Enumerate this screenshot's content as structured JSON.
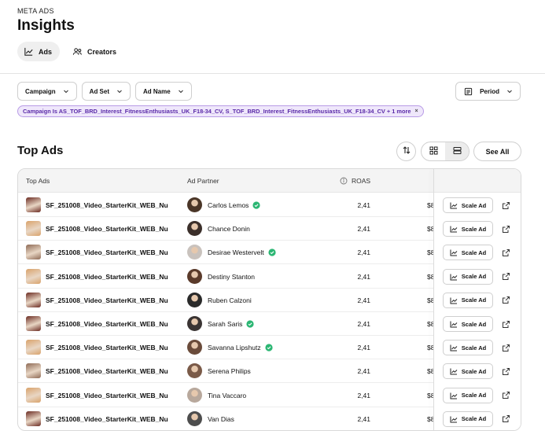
{
  "header": {
    "eyebrow": "META ADS",
    "title": "Insights"
  },
  "tabs": [
    {
      "label": "Ads",
      "icon": "line-chart-icon",
      "active": true
    },
    {
      "label": "Creators",
      "icon": "users-icon",
      "active": false
    }
  ],
  "filters": {
    "campaign": "Campaign",
    "ad_set": "Ad Set",
    "ad_name": "Ad Name",
    "period": "Period"
  },
  "active_filter": {
    "text": "Campaign Is AS_TOF_BRD_Interest_FitnessEnthusiasts_UK_F18-34_CV, S_TOF_BRD_Interest_FitnessEnthusiasts_UK_F18-34_CV + 1 more",
    "remove": "×"
  },
  "section": {
    "title": "Top Ads",
    "see_all": "See All"
  },
  "table": {
    "headers": {
      "ads": "Top Ads",
      "partner": "Ad Partner",
      "roas": "ROAS"
    },
    "scale_label": "Scale Ad",
    "rows": [
      {
        "ad": "SF_251008_Video_StarterKit_WEB_Nu",
        "partner": "Carlos Lemos",
        "verified": true,
        "roas": "2,41",
        "spend": "$8",
        "thumb": "#6b2b22",
        "avatar": "#4a3527"
      },
      {
        "ad": "SF_251008_Video_StarterKit_WEB_Nu",
        "partner": "Chance Donin",
        "verified": false,
        "roas": "2,41",
        "spend": "$8",
        "thumb": "#d9a26a",
        "avatar": "#3b2f2a"
      },
      {
        "ad": "SF_251008_Video_StarterKit_WEB_Nu",
        "partner": "Desirae Westervelt",
        "verified": true,
        "roas": "2,41",
        "spend": "$8",
        "thumb": "#8e6a55",
        "avatar": "#c9c2bd"
      },
      {
        "ad": "SF_251008_Video_StarterKit_WEB_Nu",
        "partner": "Destiny Stanton",
        "verified": false,
        "roas": "2,41",
        "spend": "$8",
        "thumb": "#d9a26a",
        "avatar": "#5a3a2a"
      },
      {
        "ad": "SF_251008_Video_StarterKit_WEB_Nu",
        "partner": "Ruben Calzoni",
        "verified": false,
        "roas": "2,41",
        "spend": "$8",
        "thumb": "#6b2b22",
        "avatar": "#2a2a2a"
      },
      {
        "ad": "SF_251008_Video_StarterKit_WEB_Nu",
        "partner": "Sarah Saris",
        "verified": true,
        "roas": "2,41",
        "spend": "$8",
        "thumb": "#6b2b22",
        "avatar": "#3a3433"
      },
      {
        "ad": "SF_251008_Video_StarterKit_WEB_Nu",
        "partner": "Savanna Lipshutz",
        "verified": true,
        "roas": "2,41",
        "spend": "$8",
        "thumb": "#d9a26a",
        "avatar": "#6a4b3a"
      },
      {
        "ad": "SF_251008_Video_StarterKit_WEB_Nu",
        "partner": "Serena Philips",
        "verified": false,
        "roas": "2,41",
        "spend": "$8",
        "thumb": "#8e6a55",
        "avatar": "#7a5a48"
      },
      {
        "ad": "SF_251008_Video_StarterKit_WEB_Nu",
        "partner": "Tina Vaccaro",
        "verified": false,
        "roas": "2,41",
        "spend": "$8",
        "thumb": "#d9a26a",
        "avatar": "#b8a89c"
      },
      {
        "ad": "SF_251008_Video_StarterKit_WEB_Nu",
        "partner": "Van Dias",
        "verified": false,
        "roas": "2,41",
        "spend": "$8",
        "thumb": "#6b2b22",
        "avatar": "#4d4d4d"
      }
    ]
  },
  "colors": {
    "verified": "#2bb673",
    "chip_bg": "#efe7fb",
    "chip_text": "#5a2aa8"
  }
}
